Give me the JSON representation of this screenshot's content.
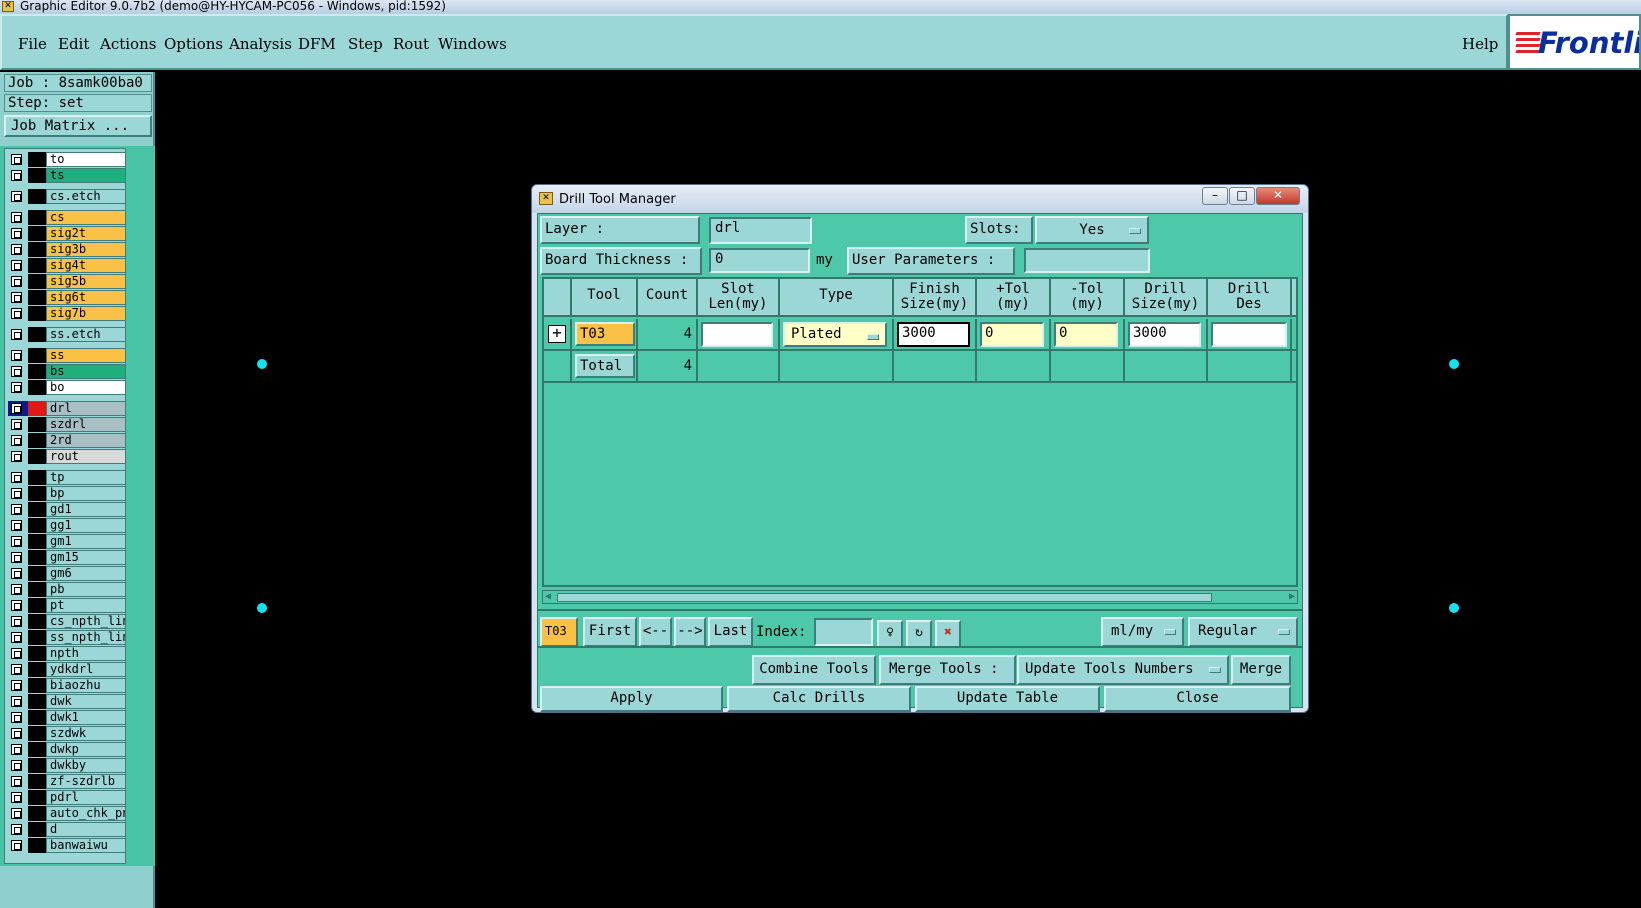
{
  "window": {
    "title": "Graphic Editor 9.0.7b2 (demo@HY-HYCAM-PC056 - Windows, pid:1592)"
  },
  "menubar": {
    "items": [
      "File",
      "Edit",
      "Actions",
      "Options",
      "Analysis",
      "DFM",
      "Step",
      "Rout",
      "Windows"
    ],
    "help": "Help",
    "logo_text": "Frontline"
  },
  "left_panel": {
    "job": "Job : 8samk00ba0",
    "step": "Step: set",
    "job_matrix_button": "Job Matrix ...",
    "layers": [
      {
        "name": "to",
        "color": "#ffffff"
      },
      {
        "name": "ts",
        "color": "#1fae7e"
      },
      {
        "name": "cs.etch",
        "color": "#9ad7d6"
      },
      {
        "name": "cs",
        "color": "#f9c246"
      },
      {
        "name": "sig2t",
        "color": "#f9c246"
      },
      {
        "name": "sig3b",
        "color": "#f9c246"
      },
      {
        "name": "sig4t",
        "color": "#f9c246"
      },
      {
        "name": "sig5b",
        "color": "#f9c246"
      },
      {
        "name": "sig6t",
        "color": "#f9c246"
      },
      {
        "name": "sig7b",
        "color": "#f9c246"
      },
      {
        "name": "ss.etch",
        "color": "#9ad7d6"
      },
      {
        "name": "ss",
        "color": "#f9c246"
      },
      {
        "name": "bs",
        "color": "#1fae7e"
      },
      {
        "name": "bo",
        "color": "#ffffff"
      },
      {
        "name": "drl",
        "color": "#a9bfc6"
      },
      {
        "name": "szdrl",
        "color": "#a9bfc6"
      },
      {
        "name": "2rd",
        "color": "#a9bfc6"
      },
      {
        "name": "rout",
        "color": "#d9d9d9"
      },
      {
        "name": "tp",
        "color": "#9ad7d6"
      },
      {
        "name": "bp",
        "color": "#9ad7d6"
      },
      {
        "name": "gd1",
        "color": "#9ad7d6"
      },
      {
        "name": "gg1",
        "color": "#9ad7d6"
      },
      {
        "name": "gm1",
        "color": "#9ad7d6"
      },
      {
        "name": "gm15",
        "color": "#9ad7d6"
      },
      {
        "name": "gm6",
        "color": "#9ad7d6"
      },
      {
        "name": "pb",
        "color": "#9ad7d6"
      },
      {
        "name": "pt",
        "color": "#9ad7d6"
      },
      {
        "name": "cs_npth_line",
        "color": "#9ad7d6"
      },
      {
        "name": "ss_npth_line",
        "color": "#9ad7d6"
      },
      {
        "name": "npth",
        "color": "#9ad7d6"
      },
      {
        "name": "ydkdrl",
        "color": "#9ad7d6"
      },
      {
        "name": "biaozhu",
        "color": "#9ad7d6"
      },
      {
        "name": "dwk",
        "color": "#9ad7d6"
      },
      {
        "name": "dwk1",
        "color": "#9ad7d6"
      },
      {
        "name": "szdwk",
        "color": "#9ad7d6"
      },
      {
        "name": "dwkp",
        "color": "#9ad7d6"
      },
      {
        "name": "dwkby",
        "color": "#9ad7d6"
      },
      {
        "name": "zf-szdrlb",
        "color": "#9ad7d6"
      },
      {
        "name": "pdrl",
        "color": "#9ad7d6"
      },
      {
        "name": "auto_chk_pnl",
        "color": "#9ad7d6"
      },
      {
        "name": "d",
        "color": "#9ad7d6"
      },
      {
        "name": "banwaiwu",
        "color": "#9ad7d6"
      }
    ]
  },
  "dialog": {
    "title": "Drill Tool Manager",
    "layer_label": "Layer              :",
    "layer_value": "drl",
    "slots_label": "Slots:",
    "slots_value": "Yes",
    "board_thickness_label": "Board Thickness :",
    "board_thickness_value": "0",
    "board_thickness_unit": "my",
    "user_parameters_label": "User Parameters :",
    "user_parameters_value": "",
    "table": {
      "headers": [
        "Tool",
        "Count",
        "Slot\nLen(my)",
        "Type",
        "Finish\nSize(my)",
        "+Tol\n(my)",
        "-Tol\n(my)",
        "Drill\nSize(my)",
        "Drill\nDes"
      ],
      "rows": [
        {
          "tool": "T03",
          "count": "4",
          "slot_len": "",
          "type": "Plated",
          "finish_size": "3000",
          "plus_tol": "0",
          "minus_tol": "0",
          "drill_size": "3000",
          "drill_des": ""
        }
      ],
      "total_label": "Total",
      "total_count": "4"
    },
    "nav": {
      "current_tool": "T03",
      "first": "First",
      "prev": "<--",
      "next": "-->",
      "last": "Last",
      "index_label": "Index:",
      "index_value": "",
      "units": "ml/my",
      "mode": "Regular"
    },
    "actions": {
      "combine_tools": "Combine Tools",
      "merge_tools_label": "Merge Tools :",
      "update_tools_numbers": "Update Tools Numbers",
      "merge": "Merge",
      "apply": "Apply",
      "calc_drills": "Calc Drills",
      "update_table": "Update Table",
      "close": "Close"
    }
  },
  "colors": {
    "background": "#000000",
    "panel": "#9ad7d6",
    "dialog_body": "#4dc9a9",
    "highlight_tool": "#f9c246",
    "canvas_dot": "#11e4f0"
  }
}
